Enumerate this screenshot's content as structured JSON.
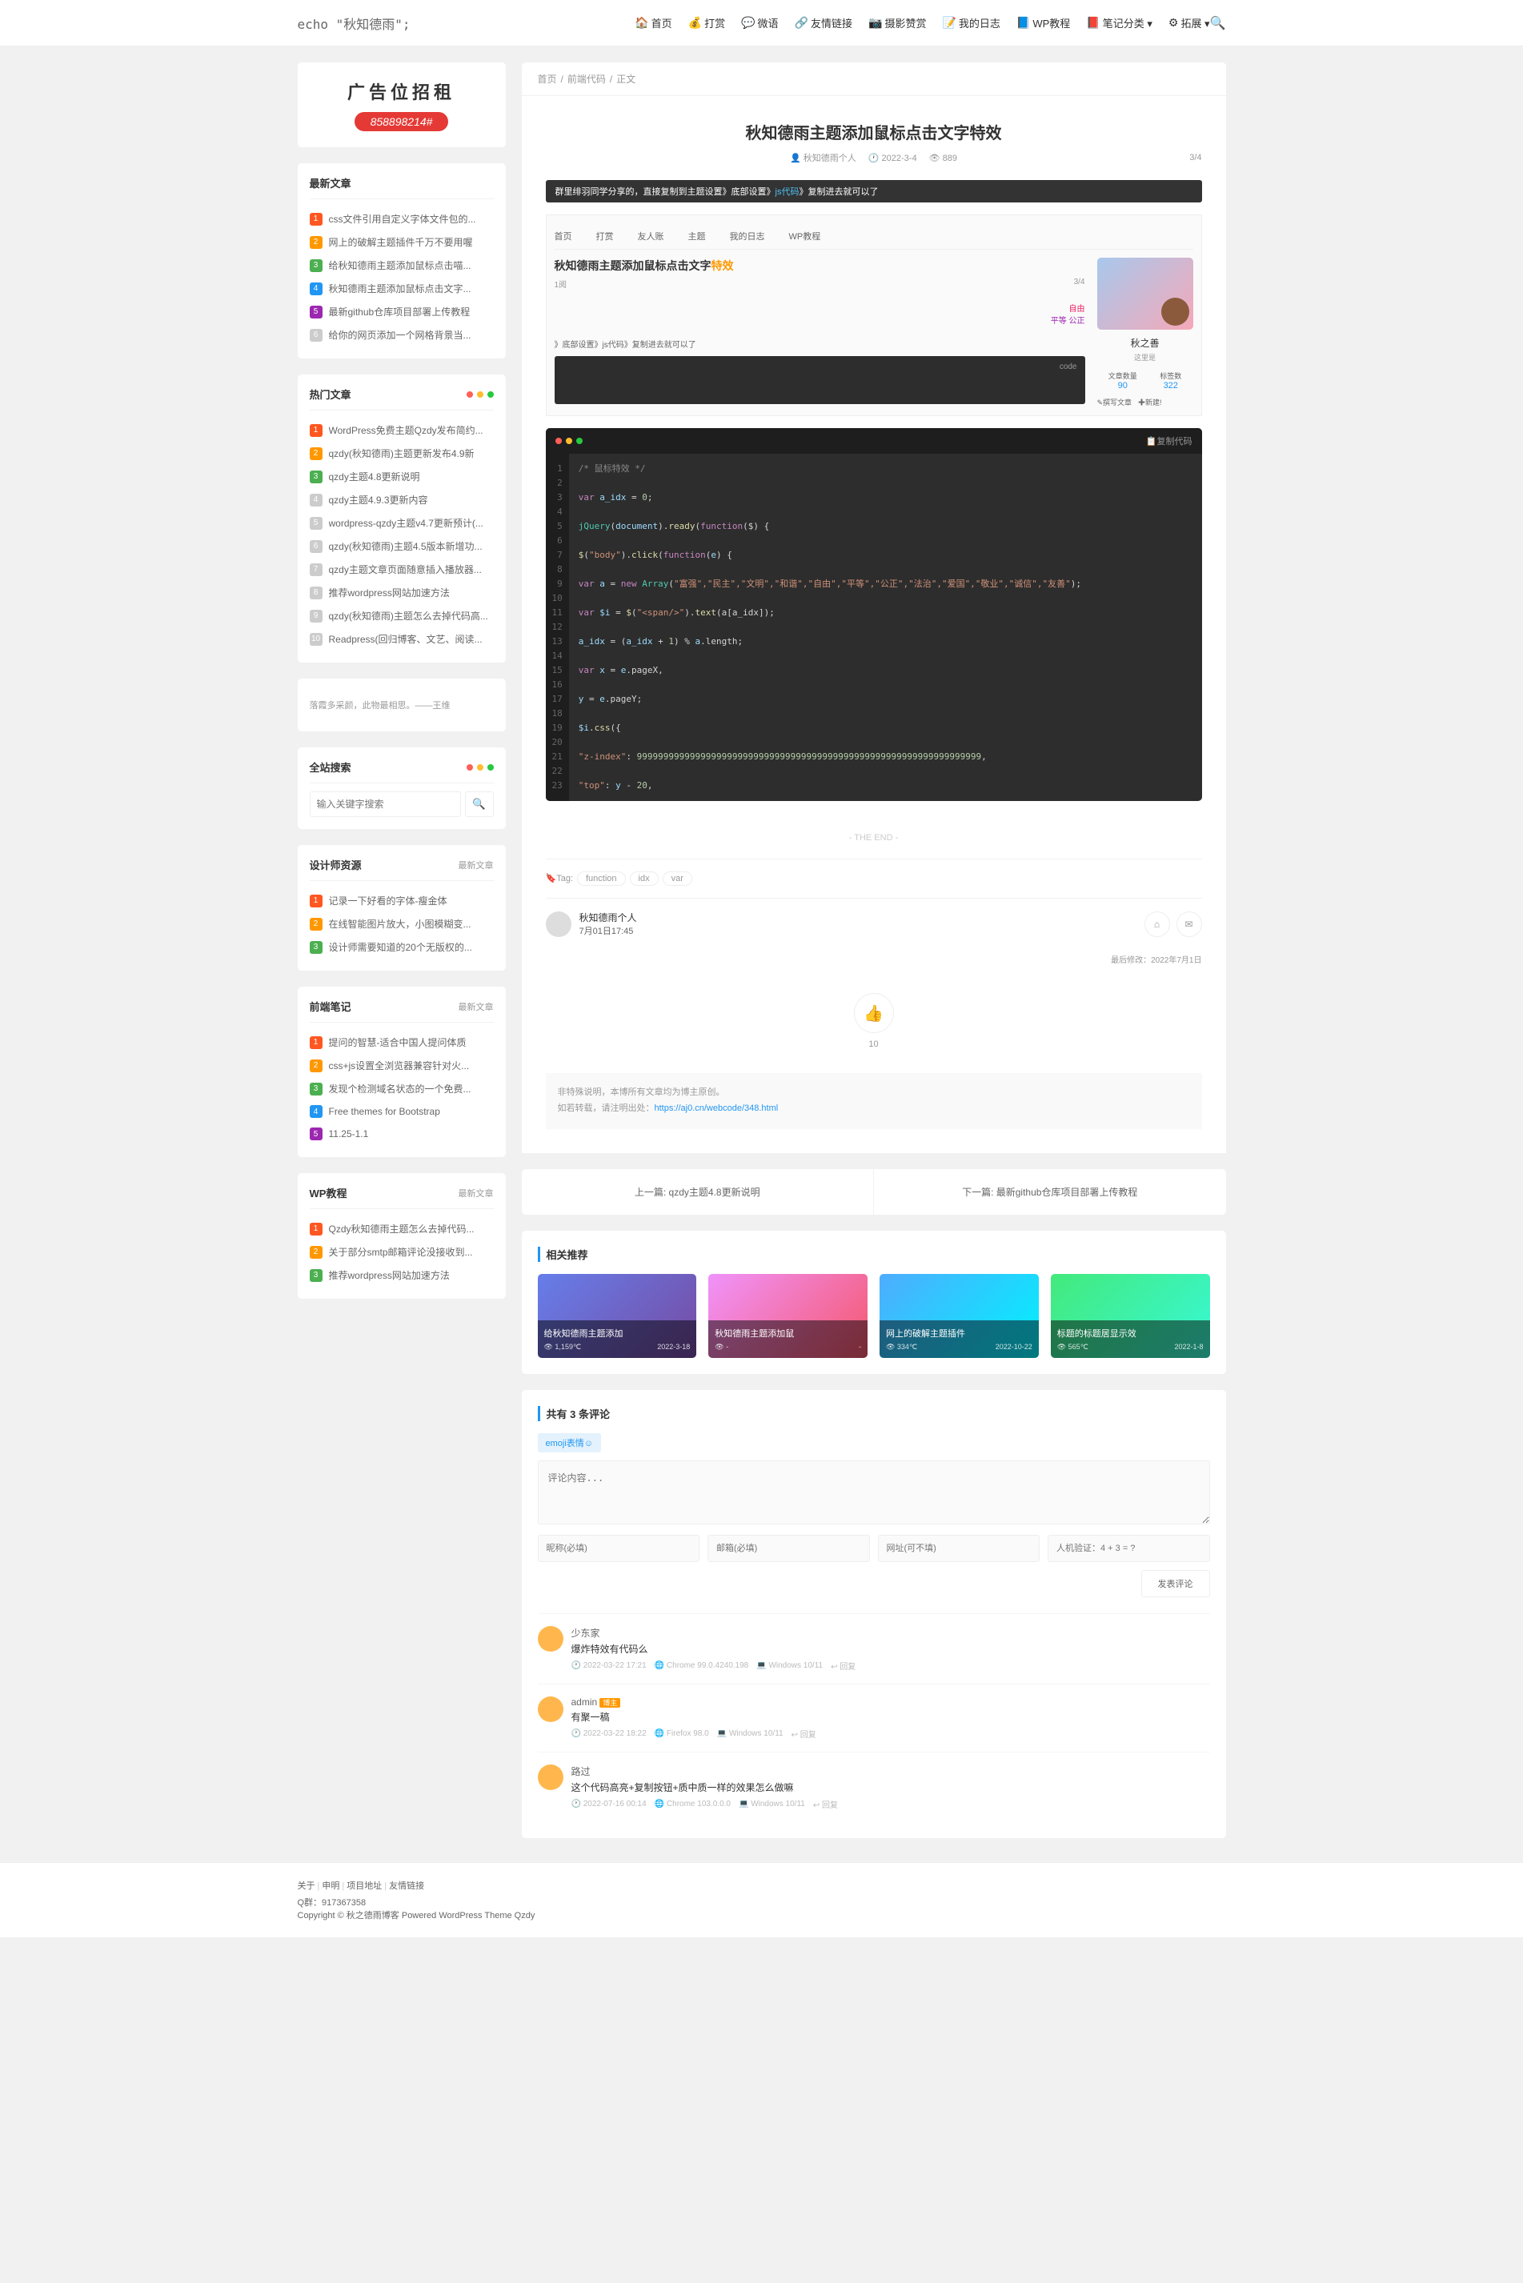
{
  "header": {
    "logo": "echo \"秋知德雨\";",
    "nav": [
      {
        "icon": "🏠",
        "label": "首页"
      },
      {
        "icon": "💰",
        "label": "打赏"
      },
      {
        "icon": "💬",
        "label": "微语"
      },
      {
        "icon": "🔗",
        "label": "友情链接"
      },
      {
        "icon": "📷",
        "label": "摄影赞赏"
      },
      {
        "icon": "📝",
        "label": "我的日志"
      },
      {
        "icon": "📘",
        "label": "WP教程"
      },
      {
        "icon": "📕",
        "label": "笔记分类 ▾"
      },
      {
        "icon": "⚙",
        "label": "拓展 ▾"
      }
    ]
  },
  "ad": {
    "title": "广告位招租",
    "phone": "858898214#"
  },
  "widgets": {
    "latest": {
      "title": "最新文章",
      "items": [
        "css文件引用自定义字体文件包的...",
        "网上的破解主题插件千万不要用喔",
        "给秋知德雨主题添加鼠标点击喵...",
        "秋知德雨主题添加鼠标点击文字...",
        "最新github仓库项目部署上传教程",
        "给你的网页添加一个网格背景当..."
      ]
    },
    "hot": {
      "title": "热门文章",
      "items": [
        "WordPress免费主题Qzdy发布简约...",
        "qzdy(秋知德雨)主题更新发布4.9新",
        "qzdy主题4.8更新说明",
        "qzdy主题4.9.3更新内容",
        "wordpress-qzdy主题v4.7更新预计(...",
        "qzdy(秋知德雨)主题4.5版本新增功...",
        "qzdy主题文章页面随意插入播放器...",
        "推荐wordpress网站加速方法",
        "qzdy(秋知德雨)主题怎么去掉代码高...",
        "Readpress(回归博客、文艺、阅读..."
      ]
    },
    "quote": "落霞多采颜，此物最相思。——王维",
    "search": {
      "title": "全站搜索",
      "placeholder": "输入关键字搜索"
    },
    "designer": {
      "title": "设计师资源",
      "more": "最新文章",
      "items": [
        "记录一下好看的字体-瘦金体",
        "在线智能图片放大，小图模糊变...",
        "设计师需要知道的20个无版权的..."
      ]
    },
    "frontend": {
      "title": "前端笔记",
      "more": "最新文章",
      "items": [
        "提问的智慧-适合中国人提问体质",
        "css+js设置全浏览器兼容针对火...",
        "发现个检测域名状态的一个免费...",
        "Free themes for Bootstrap",
        "11.25-1.1"
      ]
    },
    "wp": {
      "title": "WP教程",
      "more": "最新文章",
      "items": [
        "Qzdy秋知德雨主题怎么去掉代码...",
        "关于部分smtp邮箱评论没接收到...",
        "推荐wordpress网站加速方法"
      ]
    }
  },
  "breadcrumb": [
    "首页",
    "前端代码",
    "正文"
  ],
  "article": {
    "title": "秋知德雨主题添加鼠标点击文字特效",
    "author": "秋知德雨个人",
    "date": "2022-3-4",
    "views": "889",
    "slot": "3/4",
    "notice_pre": "群里绯羽同学分享的，直接复制到主题设置》底部设置》",
    "notice_hl": "js代码",
    "notice_suf": "》复制进去就可以了",
    "preview": {
      "tabs": [
        "首页",
        "打赏",
        "友人账",
        "主题",
        "我的日志",
        "WP教程"
      ],
      "title_pre": "秋知德雨主题添加鼠标点击文字",
      "title_hl": "特效",
      "sub": "1阅",
      "slot2": "3/4",
      "word1": "自由",
      "word2": "平等",
      "word3": "公正",
      "codeline": "》底部设置》js代码》复制进去就可以了",
      "code_tag": "code",
      "name": "秋之善",
      "desc": "这里是",
      "stat1_label": "文章数量",
      "stat1_num": "90",
      "stat2_label": "标签数",
      "stat2_num": "322",
      "action1": "✎撰写文章",
      "action2": "✚新建!"
    }
  },
  "code": {
    "copy": "📋复制代码",
    "lines": [
      {
        "t": "/* 鼠标特效 */",
        "c": "c-comment"
      },
      {
        "t": "",
        "c": ""
      },
      {
        "t": "var a_idx = 0;",
        "parts": [
          {
            "t": "var ",
            "c": "c-kw"
          },
          {
            "t": "a_idx",
            "c": "c-var"
          },
          {
            "t": " = ",
            "c": "c-op"
          },
          {
            "t": "0",
            "c": "c-num"
          },
          {
            "t": ";",
            "c": "c-op"
          }
        ]
      },
      {
        "t": "",
        "c": ""
      },
      {
        "t": "jQuery(document).ready(function($) {",
        "parts": [
          {
            "t": "jQuery",
            "c": "c-jq"
          },
          {
            "t": "(",
            "c": "c-op"
          },
          {
            "t": "document",
            "c": "c-var"
          },
          {
            "t": ").",
            "c": "c-op"
          },
          {
            "t": "ready",
            "c": "c-fn"
          },
          {
            "t": "(",
            "c": "c-op"
          },
          {
            "t": "function",
            "c": "c-kw"
          },
          {
            "t": "($",
            "c": "c-op"
          },
          {
            "t": ") {",
            "c": "c-op"
          }
        ]
      },
      {
        "t": "",
        "c": ""
      },
      {
        "t": "$(\"body\").click(function(e) {",
        "parts": [
          {
            "t": "$",
            "c": "c-fn"
          },
          {
            "t": "(",
            "c": "c-op"
          },
          {
            "t": "\"body\"",
            "c": "c-str"
          },
          {
            "t": ").",
            "c": "c-op"
          },
          {
            "t": "click",
            "c": "c-fn"
          },
          {
            "t": "(",
            "c": "c-op"
          },
          {
            "t": "function",
            "c": "c-kw"
          },
          {
            "t": "(",
            "c": "c-op"
          },
          {
            "t": "e",
            "c": "c-var"
          },
          {
            "t": ") {",
            "c": "c-op"
          }
        ]
      },
      {
        "t": "",
        "c": ""
      },
      {
        "t": "var a = new Array(\"富强\",\"民主\",\"文明\",\"和谐\",\"自由\",\"平等\",\"公正\",\"法治\",\"爱国\",\"敬业\",\"诚信\",\"友善\");",
        "parts": [
          {
            "t": "var ",
            "c": "c-kw"
          },
          {
            "t": "a",
            "c": "c-var"
          },
          {
            "t": " = ",
            "c": "c-op"
          },
          {
            "t": "new ",
            "c": "c-kw"
          },
          {
            "t": "Array",
            "c": "c-jq"
          },
          {
            "t": "(",
            "c": "c-op"
          },
          {
            "t": "\"富强\",\"民主\",\"文明\",\"和谐\",\"自由\",\"平等\",\"公正\",\"法治\",\"爱国\",\"敬业\",\"诚信\",\"友善\"",
            "c": "c-str"
          },
          {
            "t": ");",
            "c": "c-op"
          }
        ]
      },
      {
        "t": "",
        "c": ""
      },
      {
        "t": "var $i = $(\"<span/>\").text(a[a_idx]);",
        "parts": [
          {
            "t": "var ",
            "c": "c-kw"
          },
          {
            "t": "$i",
            "c": "c-var"
          },
          {
            "t": " = ",
            "c": "c-op"
          },
          {
            "t": "$",
            "c": "c-fn"
          },
          {
            "t": "(",
            "c": "c-op"
          },
          {
            "t": "\"<span/>\"",
            "c": "c-str"
          },
          {
            "t": ").",
            "c": "c-op"
          },
          {
            "t": "text",
            "c": "c-fn"
          },
          {
            "t": "(a[a_idx]);",
            "c": "c-op"
          }
        ]
      },
      {
        "t": "",
        "c": ""
      },
      {
        "t": "a_idx = (a_idx + 1) % a.length;",
        "parts": [
          {
            "t": "a_idx",
            "c": "c-var"
          },
          {
            "t": " = (",
            "c": "c-op"
          },
          {
            "t": "a_idx",
            "c": "c-var"
          },
          {
            "t": " + ",
            "c": "c-op"
          },
          {
            "t": "1",
            "c": "c-num"
          },
          {
            "t": ") % ",
            "c": "c-op"
          },
          {
            "t": "a",
            "c": "c-var"
          },
          {
            "t": ".length;",
            "c": "c-op"
          }
        ]
      },
      {
        "t": "",
        "c": ""
      },
      {
        "t": "var x = e.pageX,",
        "parts": [
          {
            "t": "var ",
            "c": "c-kw"
          },
          {
            "t": "x",
            "c": "c-var"
          },
          {
            "t": " = ",
            "c": "c-op"
          },
          {
            "t": "e",
            "c": "c-var"
          },
          {
            "t": ".pageX,",
            "c": "c-op"
          }
        ]
      },
      {
        "t": "",
        "c": ""
      },
      {
        "t": "y = e.pageY;",
        "parts": [
          {
            "t": "y",
            "c": "c-var"
          },
          {
            "t": " = ",
            "c": "c-op"
          },
          {
            "t": "e",
            "c": "c-var"
          },
          {
            "t": ".pageY;",
            "c": "c-op"
          }
        ]
      },
      {
        "t": "",
        "c": ""
      },
      {
        "t": "$i.css({",
        "parts": [
          {
            "t": "$i",
            "c": "c-var"
          },
          {
            "t": ".",
            "c": "c-op"
          },
          {
            "t": "css",
            "c": "c-fn"
          },
          {
            "t": "({",
            "c": "c-op"
          }
        ]
      },
      {
        "t": "",
        "c": ""
      },
      {
        "t": "\"z-index\": 99999999999999999999999999999999999999999999999999999999999999999,",
        "parts": [
          {
            "t": "\"z-index\"",
            "c": "c-str"
          },
          {
            "t": ": ",
            "c": "c-op"
          },
          {
            "t": "99999999999999999999999999999999999999999999999999999999999999999",
            "c": "c-num"
          },
          {
            "t": ",",
            "c": "c-op"
          }
        ]
      },
      {
        "t": "",
        "c": ""
      },
      {
        "t": "\"top\": y - 20,",
        "parts": [
          {
            "t": "\"top\"",
            "c": "c-str"
          },
          {
            "t": ": ",
            "c": "c-op"
          },
          {
            "t": "y",
            "c": "c-var"
          },
          {
            "t": " - ",
            "c": "c-op"
          },
          {
            "t": "20",
            "c": "c-num"
          },
          {
            "t": ",",
            "c": "c-op"
          }
        ]
      }
    ]
  },
  "end": "- THE END -",
  "tags": {
    "label": "Tag:",
    "items": [
      "function",
      "idx",
      "var"
    ]
  },
  "authorBox": {
    "name": "秋知德雨个人",
    "date": "7月01日17:45"
  },
  "modified": "最后修改：2022年7月1日",
  "like": "10",
  "copyright": {
    "line1": "非特殊说明，本博所有文章均为博主原创。",
    "line2_pre": "如若转载，请注明出处：",
    "line2_link": "https://aj0.cn/webcode/348.html"
  },
  "navLinks": {
    "prev": "上一篇: qzdy主题4.8更新说明",
    "next": "下一篇: 最新github仓库项目部署上传教程"
  },
  "related": {
    "title": "相关推荐",
    "items": [
      {
        "title": "给秋知德雨主题添加",
        "views": "1,159℃",
        "date": "2022-3-18"
      },
      {
        "title": "秋知德雨主题添加鼠",
        "views": "-",
        "date": "-"
      },
      {
        "title": "网上的破解主题插件",
        "views": "334℃",
        "date": "2022-10-22"
      },
      {
        "title": "标题的标题居显示效",
        "views": "565℃",
        "date": "2022-1-8"
      }
    ]
  },
  "comments": {
    "title": "共有 3 条评论",
    "emoji": "emoji表情☺",
    "placeholder": "评论内容...",
    "name_ph": "昵称(必填)",
    "email_ph": "邮箱(必填)",
    "url_ph": "网址(可不填)",
    "captcha_ph": "人机验证：4 + 3 = ?",
    "submit": "发表评论",
    "items": [
      {
        "author": "少东家",
        "text": "爆炸特效有代码么",
        "date": "2022-03-22 17:21",
        "browser": "Chrome 99.0.4240.198",
        "os": "Windows 10/11",
        "reply": "↩ 回复"
      },
      {
        "author": "admin",
        "owner": "博主",
        "text": "有聚一稿",
        "date": "2022-03-22 18:22",
        "browser": "Firefox 98.0",
        "os": "Windows 10/11",
        "reply": "↩ 回复"
      },
      {
        "author": "路过",
        "text": "这个代码高亮+复制按钮+质中质一样的效果怎么做嘛",
        "date": "2022-07-16 00:14",
        "browser": "Chrome 103.0.0.0",
        "os": "Windows 10/11",
        "reply": "↩ 回复"
      }
    ]
  },
  "footer": {
    "links": [
      "关于",
      "申明",
      "项目地址",
      "友情链接"
    ],
    "qq": "Q群：917367358",
    "copy": "Copyright © 秋之德雨博客 Powered WordPress Theme Qzdy"
  }
}
